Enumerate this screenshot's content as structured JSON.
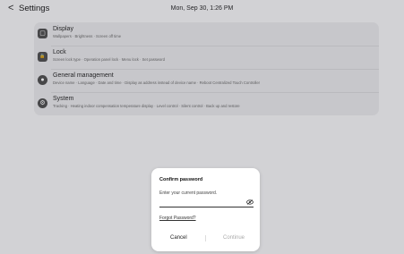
{
  "header": {
    "back_glyph": "<",
    "title": "Settings",
    "datetime": "Mon, Sep 30, 1:26 PM"
  },
  "settings": {
    "items": [
      {
        "icon": "display-icon",
        "glyph": "▢",
        "name": "Display",
        "sub": "Wallpapers  ·  Brightness  ·  Screen off time"
      },
      {
        "icon": "lock-icon",
        "glyph": "🔒",
        "name": "Lock",
        "sub": "Screen lock type  ·  Operation panel lock  ·  Menu lock  ·  Set password"
      },
      {
        "icon": "general-management-icon",
        "glyph": "●",
        "name": "General management",
        "sub": "Device name  ·  Language  ·  Date and time  ·  Display as address instead of device name  ·  Reboot Centralized Touch Controller"
      },
      {
        "icon": "system-icon",
        "glyph": "⚙",
        "name": "System",
        "sub": "Tracking  ·  Heating indoor compensation temperature display  ·  Level control  ·  Silent control  ·  Back up and restore"
      }
    ]
  },
  "dialog": {
    "title": "Confirm password",
    "prompt": "Enter your current password.",
    "password_value": "",
    "eye_icon": "eye-off-icon",
    "forgot_label": "Forgot Password?",
    "cancel_label": "Cancel",
    "continue_label": "Continue"
  }
}
